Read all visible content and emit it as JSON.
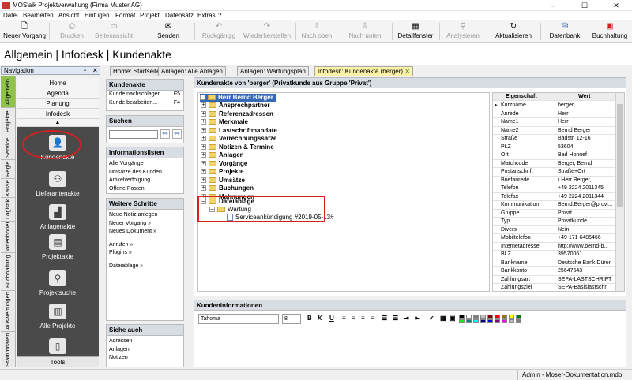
{
  "window": {
    "title": "MOS'aik Projektverwaltung (Firma Muster AG)",
    "min": "–",
    "max": "☐",
    "close": "✕"
  },
  "menu": [
    "Datei",
    "Bearbeiten",
    "Ansicht",
    "Einfügen",
    "Format",
    "Projekt",
    "Datensatz",
    "Extras",
    "?"
  ],
  "toolbar": [
    {
      "label": "Neuer Vorgang",
      "icon": "file-icon",
      "enabled": true
    },
    {
      "label": "Drucken",
      "icon": "print-icon",
      "enabled": false
    },
    {
      "label": "Seitenansicht",
      "icon": "preview-icon",
      "enabled": false
    },
    {
      "label": "Senden",
      "icon": "mail-icon",
      "enabled": true
    },
    {
      "label": "Rückgängig",
      "icon": "undo-icon",
      "enabled": false
    },
    {
      "label": "Wiederherstellen",
      "icon": "redo-icon",
      "enabled": false
    },
    {
      "label": "Nach oben",
      "icon": "arrow-up-icon",
      "enabled": false
    },
    {
      "label": "Nach unten",
      "icon": "arrow-down-icon",
      "enabled": false
    },
    {
      "label": "Detailfenster",
      "icon": "detail-window-icon",
      "enabled": true
    },
    {
      "label": "Analysieren",
      "icon": "analyze-icon",
      "enabled": false
    },
    {
      "label": "Aktualisieren",
      "icon": "refresh-icon",
      "enabled": true
    },
    {
      "label": "Datenbank",
      "icon": "database-icon",
      "enabled": true
    },
    {
      "label": "Buchhaltung",
      "icon": "accounting-icon",
      "enabled": true
    }
  ],
  "header": {
    "title": "Allgemein | Infodesk | Kundenakte"
  },
  "navigation": {
    "title": "Navigation",
    "pin": "ᵜ",
    "close": "✕",
    "vtabs": [
      "Allgemein",
      "Projekte",
      "Service",
      "Regie",
      "Kasse",
      "Logistik",
      "Ionenhnner",
      "Buchhaltung",
      "Auswertungen",
      "Stammdaten"
    ],
    "links": [
      "Home",
      "Agenda",
      "Planung",
      "Infodesk"
    ],
    "items": [
      "Kundenakte",
      "Lieferantenakte",
      "Anlagenakte",
      "Projektakte",
      "Projektsuche",
      "Alle Projekte"
    ],
    "tools": "Tools"
  },
  "tabs": [
    "Home: Startseite",
    "Anlagen: Alle Anlagen",
    "Anlagen: Wartungsplan",
    "Infodesk: Kundenakte (berger)"
  ],
  "kundenakte": {
    "title": "Kundenakte",
    "links": [
      {
        "label": "Kunde nachschlagen...",
        "key": "F5"
      },
      {
        "label": "Kunde bearbeiten...",
        "key": "F4"
      }
    ]
  },
  "suchen": {
    "title": "Suchen",
    "value": ""
  },
  "infolisten": {
    "title": "Informationslisten",
    "links": [
      "Alle Vorgänge",
      "Umsätze des Kunden",
      "Artikelverfolgung",
      "Offene Posten"
    ]
  },
  "weitere": {
    "title": "Weitere Schritte",
    "links": [
      "Neue Notiz anlegen",
      "Neuer Vorgang »",
      "Neues Dokument »",
      "",
      "Anrufen »",
      "Plugins »",
      "",
      "Dateiablage »"
    ]
  },
  "siehe": {
    "title": "Siehe auch",
    "links": [
      "Adressen",
      "Anlagen",
      "Notizen"
    ]
  },
  "main": {
    "title": "Kundenakte von 'berger' (Privatkunde aus Gruppe 'Privat')"
  },
  "tree": {
    "root": "Herr Bernd Berger",
    "nodes": [
      "Ansprechpartner",
      "Referenzadressen",
      "Merkmale",
      "Lastschriftmandate",
      "Verrechnungssätze",
      "Notizen & Termine",
      "Anlagen",
      "Vorgänge",
      "Projekte",
      "Umsätze",
      "Buchungen",
      "Mahnungen",
      "Dateiablage"
    ],
    "sub": "Wartung",
    "doc": "Serviceankündigung #2019-05-13#"
  },
  "props": {
    "col_key": "Eigenschaft",
    "col_val": "Wert",
    "rows": [
      [
        "Kurzname",
        "berger"
      ],
      [
        "Anrede",
        "Herr"
      ],
      [
        "Name1",
        "Herr"
      ],
      [
        "Name2",
        "Bernd Berger"
      ],
      [
        "Straße",
        "Badstr. 12-16"
      ],
      [
        "PLZ",
        "53604"
      ],
      [
        "Ort",
        "Bad Honnef"
      ],
      [
        "Matchcode",
        "Berger, Bernd"
      ],
      [
        "Postanschrift",
        "Straße+Ort"
      ],
      [
        "Briefanrede",
        "r Herr Berger,"
      ],
      [
        "Telefon",
        "+49 2224 2011345"
      ],
      [
        "Telefax",
        "+49 2224 2011344"
      ],
      [
        "Kommunikation",
        "Bernd.Berger@provi..."
      ],
      [
        "Gruppe",
        "Privat"
      ],
      [
        "Typ",
        "Privatkunde"
      ],
      [
        "Divers",
        "Nein"
      ],
      [
        "Mobiltelefon",
        "+49 171 6485466"
      ],
      [
        "Internetadresse",
        "http://www.bernd-b..."
      ],
      [
        "BLZ",
        "39570061"
      ],
      [
        "Bankname",
        "Deutsche Bank Düren"
      ],
      [
        "Bankkonto",
        "25647643"
      ],
      [
        "Zahlungsart",
        "SEPA-LASTSCHRIFT"
      ],
      [
        "Zahlungsziel",
        "SEPA-Basislastschr"
      ]
    ]
  },
  "kundeninfo": {
    "title": "Kundeninformationen",
    "font": "Tahoma",
    "size": "8",
    "bold": "B",
    "italic": "K",
    "underline": "U"
  },
  "status": {
    "user": "Admin - Moser-Dokumentation.mdb"
  },
  "colors": {
    "accent": "#8ec24a",
    "active_tab": "#fbf2a8",
    "highlight": "#d61f1f",
    "nav_dark": "#4a4a4a"
  }
}
